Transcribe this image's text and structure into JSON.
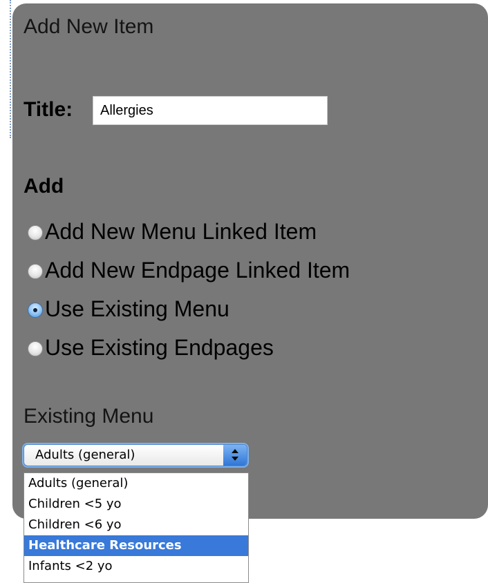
{
  "form": {
    "heading": "Add New Item",
    "title_label": "Title:",
    "title_value": "Allergies"
  },
  "add_section": {
    "heading": "Add",
    "options": [
      {
        "label": "Add New Menu Linked Item",
        "checked": false
      },
      {
        "label": "Add New Endpage Linked Item",
        "checked": false
      },
      {
        "label": "Use Existing Menu",
        "checked": true
      },
      {
        "label": "Use Existing Endpages",
        "checked": false
      }
    ]
  },
  "existing_menu": {
    "heading": "Existing Menu",
    "selected": "Adults (general)",
    "options": [
      {
        "label": "Adults (general)",
        "highlighted": false
      },
      {
        "label": "Children <5 yo",
        "highlighted": false
      },
      {
        "label": "Children <6 yo",
        "highlighted": false
      },
      {
        "label": "Healthcare Resources",
        "highlighted": true
      },
      {
        "label": "Infants <2 yo",
        "highlighted": false
      }
    ]
  },
  "colors": {
    "panel": "#787878",
    "highlight": "#3879d9"
  }
}
